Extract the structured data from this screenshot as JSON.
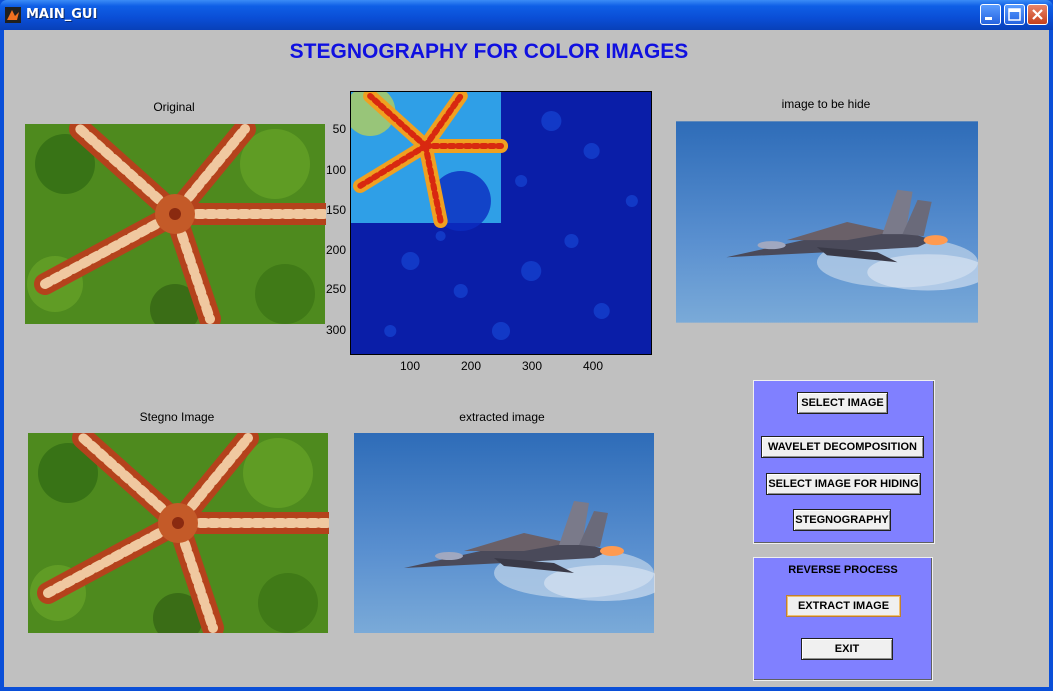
{
  "window": {
    "title": "MAIN_GUI"
  },
  "heading": "STEGNOGRAPHY FOR COLOR IMAGES",
  "labels": {
    "original": "Original",
    "hide": "image to be hide",
    "stegno": "Stegno Image",
    "extracted": "extracted image"
  },
  "plot": {
    "y_ticks": [
      "50",
      "100",
      "150",
      "200",
      "250",
      "300"
    ],
    "x_ticks": [
      "100",
      "200",
      "300",
      "400"
    ]
  },
  "panel1": {
    "buttons": [
      "SELECT IMAGE",
      "WAVELET DECOMPOSITION",
      "SELECT IMAGE FOR HIDING",
      "STEGNOGRAPHY"
    ]
  },
  "panel2": {
    "title": "REVERSE PROCESS",
    "buttons": [
      "EXTRACT IMAGE",
      "EXIT"
    ]
  },
  "icons": [
    "matlab-icon",
    "minimize-icon",
    "maximize-icon",
    "close-icon"
  ]
}
